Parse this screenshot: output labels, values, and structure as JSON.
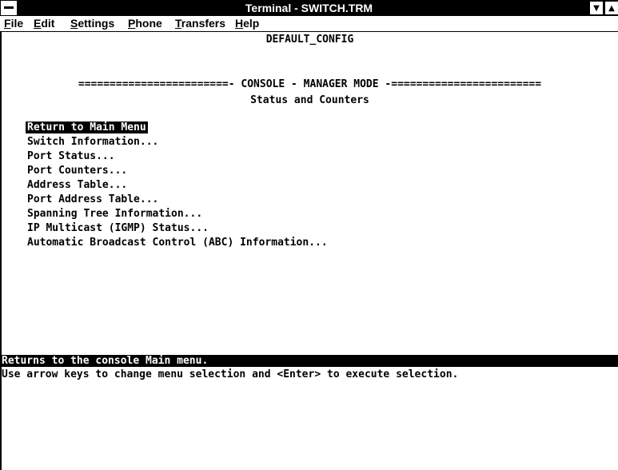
{
  "window": {
    "title": "Terminal - SWITCH.TRM",
    "minimize_glyph": "▼",
    "maximize_glyph": "▲"
  },
  "menubar": {
    "items": [
      {
        "accel": "F",
        "rest": "ile"
      },
      {
        "accel": "E",
        "rest": "dit"
      },
      {
        "accel": "S",
        "rest": "ettings"
      },
      {
        "accel": "P",
        "rest": "hone"
      },
      {
        "accel": "T",
        "rest": "ransfers"
      },
      {
        "accel": "H",
        "rest": "elp"
      }
    ]
  },
  "terminal": {
    "config_name": "DEFAULT_CONFIG",
    "mode_line": "========================- CONSOLE - MANAGER MODE -========================",
    "screen_title": "Status and Counters",
    "menu_items": [
      "Return to Main Menu",
      "Switch Information...",
      "Port Status...",
      "Port Counters...",
      "Address Table...",
      "Port Address Table...",
      "Spanning Tree Information...",
      "IP Multicast (IGMP) Status...",
      "Automatic Broadcast Control (ABC) Information..."
    ],
    "selected_index": 0,
    "help_text": "Returns to the console Main menu.",
    "instructions": "Use arrow keys to change menu selection and <Enter> to execute selection."
  }
}
